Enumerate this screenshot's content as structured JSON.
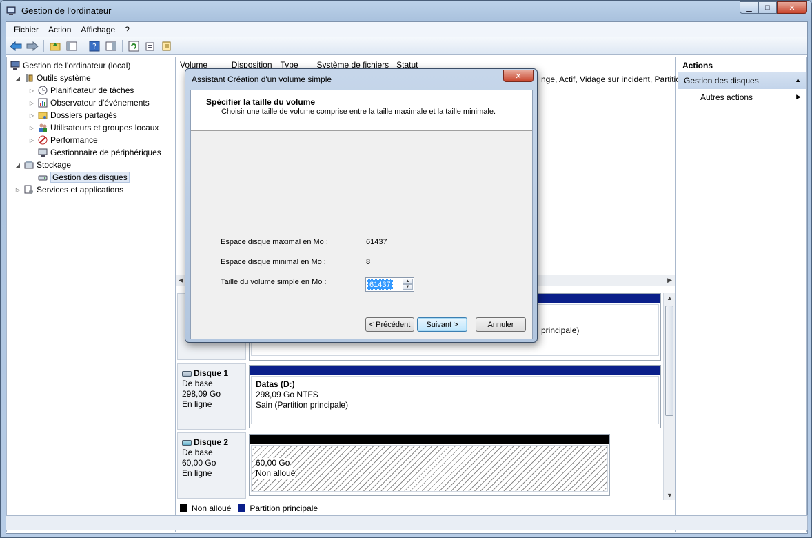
{
  "window": {
    "title": "Gestion de l'ordinateur",
    "minimize": "▁",
    "maximize": "□",
    "close": "✕"
  },
  "menu": [
    "Fichier",
    "Action",
    "Affichage",
    "?"
  ],
  "tree": {
    "root": "Gestion de l'ordinateur (local)",
    "outils": "Outils système",
    "planif": "Planificateur de tâches",
    "observ": "Observateur d'événements",
    "dossiers": "Dossiers partagés",
    "users": "Utilisateurs et groupes locaux",
    "perf": "Performance",
    "devmgr": "Gestionnaire de périphériques",
    "stockage": "Stockage",
    "disques": "Gestion des disques",
    "services": "Services et applications"
  },
  "columns": [
    "Volume",
    "Disposition",
    "Type",
    "Système de fichiers",
    "Statut"
  ],
  "volume_row_status": "nge, Actif, Vidage sur incident, Partitio",
  "disks": {
    "disk0_tail": "principale)",
    "disk1": {
      "name": "Disque 1",
      "type": "De base",
      "size": "298,09 Go",
      "state": "En ligne",
      "part_name": "Datas  (D:)",
      "part_size": "298,09 Go NTFS",
      "part_status": "Sain (Partition principale)"
    },
    "disk2": {
      "name": "Disque 2",
      "type": "De base",
      "size": "60,00 Go",
      "state": "En ligne",
      "part_size": "60,00 Go",
      "part_status": "Non alloué"
    }
  },
  "legend": {
    "unallocated": "Non alloué",
    "primary": "Partition principale"
  },
  "actions": {
    "title": "Actions",
    "section": "Gestion des disques",
    "more": "Autres actions"
  },
  "dialog": {
    "title": "Assistant Création d'un volume simple",
    "heading": "Spécifier la taille du volume",
    "subheading": "Choisir une taille de volume comprise entre la taille maximale et la taille minimale.",
    "max_label": "Espace disque maximal en Mo :",
    "max_value": "61437",
    "min_label": "Espace disque minimal en Mo :",
    "min_value": "8",
    "size_label": "Taille du volume simple en Mo :",
    "size_value": "61437",
    "back": "< Précédent",
    "next": "Suivant >",
    "cancel": "Annuler"
  },
  "colors": {
    "primary_partition": "#0a1f8a",
    "unallocated": "#000000"
  }
}
